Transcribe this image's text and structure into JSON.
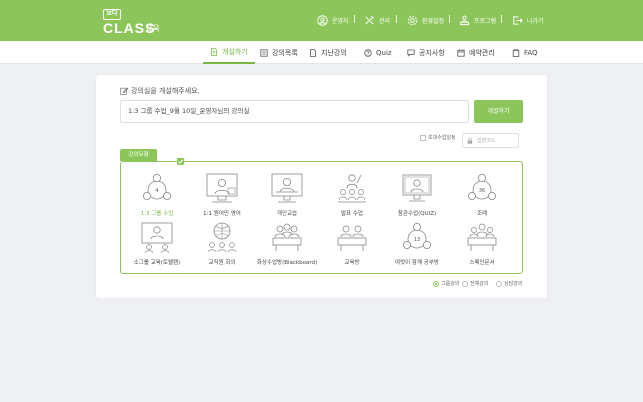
{
  "logo": {
    "small": "보다",
    "big": "CLASS",
    "sub": "교육"
  },
  "top_menu": [
    {
      "label": "운영자",
      "icon": "user-icon"
    },
    {
      "label": "관리",
      "icon": "tools-icon"
    },
    {
      "label": "환경설정",
      "icon": "gear-icon"
    },
    {
      "label": "프로그램",
      "icon": "person-desk-icon"
    },
    {
      "label": "나가기",
      "icon": "logout-icon"
    }
  ],
  "sub_nav": [
    {
      "label": "개설하기",
      "icon": "document-icon",
      "active": true
    },
    {
      "label": "강의목록",
      "icon": "list-icon",
      "active": false
    },
    {
      "label": "지난강의",
      "icon": "file-icon",
      "active": false
    },
    {
      "label": "Quiz",
      "icon": "question-icon",
      "active": false
    },
    {
      "label": "공지사항",
      "icon": "chat-icon",
      "active": false
    },
    {
      "label": "예약관리",
      "icon": "calendar-icon",
      "active": false
    },
    {
      "label": "FAQ",
      "icon": "clipboard-icon",
      "active": false
    }
  ],
  "form": {
    "prompt": "강의실을 개설해주세요.",
    "title_value": "1:3 그룹 수업_9월 10일_운영자님의 강의실",
    "open_button": "개설하기",
    "invite_only_label": "초대수업일정",
    "entry_code_placeholder": "입장코드"
  },
  "class_types": {
    "tab_label": "강의유형",
    "items": [
      {
        "label": "1:3 그룹 수업",
        "icon": "group-3-icon",
        "badge": "4",
        "selected": true
      },
      {
        "label": "1:1 원어민 영어",
        "icon": "video-lesson-icon",
        "badge": "",
        "selected": false
      },
      {
        "label": "개인교습",
        "icon": "tutor-screen-icon",
        "badge": "",
        "selected": false
      },
      {
        "label": "발표 수업",
        "icon": "presentation-icon",
        "badge": "",
        "selected": false
      },
      {
        "label": "참관수업(QUIZ)",
        "icon": "quiz-monitor-icon",
        "badge": "",
        "selected": false
      },
      {
        "label": "조례",
        "icon": "group-36-icon",
        "badge": "36",
        "selected": false
      },
      {
        "label": "소그룹 교육(토렐캠)",
        "icon": "small-group-screen-icon",
        "badge": "",
        "selected": false
      },
      {
        "label": "교직원 회의",
        "icon": "staff-meeting-icon",
        "badge": "",
        "selected": false
      },
      {
        "label": "화상수업방(Blackboard)",
        "icon": "video-class-icon",
        "badge": "",
        "selected": false
      },
      {
        "label": "교육방",
        "icon": "classroom-icon",
        "badge": "",
        "selected": false
      },
      {
        "label": "여럿이 함께 공부방",
        "icon": "study-group-icon",
        "badge": "13",
        "selected": false
      },
      {
        "label": "스페인문서",
        "icon": "seminar-icon",
        "badge": "",
        "selected": false
      }
    ]
  },
  "filters": [
    {
      "label": "그룹강의",
      "checked": true
    },
    {
      "label": "전체강의",
      "checked": false
    },
    {
      "label": "상담강의",
      "checked": false
    }
  ],
  "colors": {
    "accent": "#8cc65a",
    "accent_text": "#7ab648"
  }
}
